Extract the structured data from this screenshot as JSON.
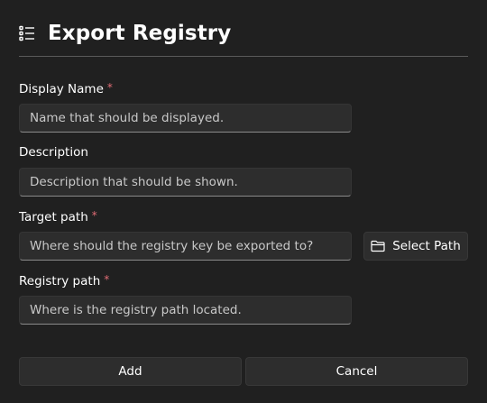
{
  "dialog": {
    "title": "Export Registry",
    "title_icon": "list-icon"
  },
  "fields": {
    "display_name": {
      "label": "Display Name",
      "required_mark": "*",
      "placeholder": "Name that should be displayed."
    },
    "description": {
      "label": "Description",
      "placeholder": "Description that should be shown."
    },
    "target_path": {
      "label": "Target path",
      "required_mark": "*",
      "placeholder": "Where should the registry key be exported to?"
    },
    "registry_path": {
      "label": "Registry path",
      "required_mark": "*",
      "placeholder": "Where is the registry path located."
    }
  },
  "buttons": {
    "select_path": {
      "label": "Select Path",
      "icon": "folder-icon"
    },
    "add": "Add",
    "cancel": "Cancel"
  },
  "colors": {
    "background": "#202020",
    "input_background": "#2d2d2d",
    "required": "#e06c75",
    "text": "#ffffff",
    "placeholder": "#c8c8c8"
  }
}
